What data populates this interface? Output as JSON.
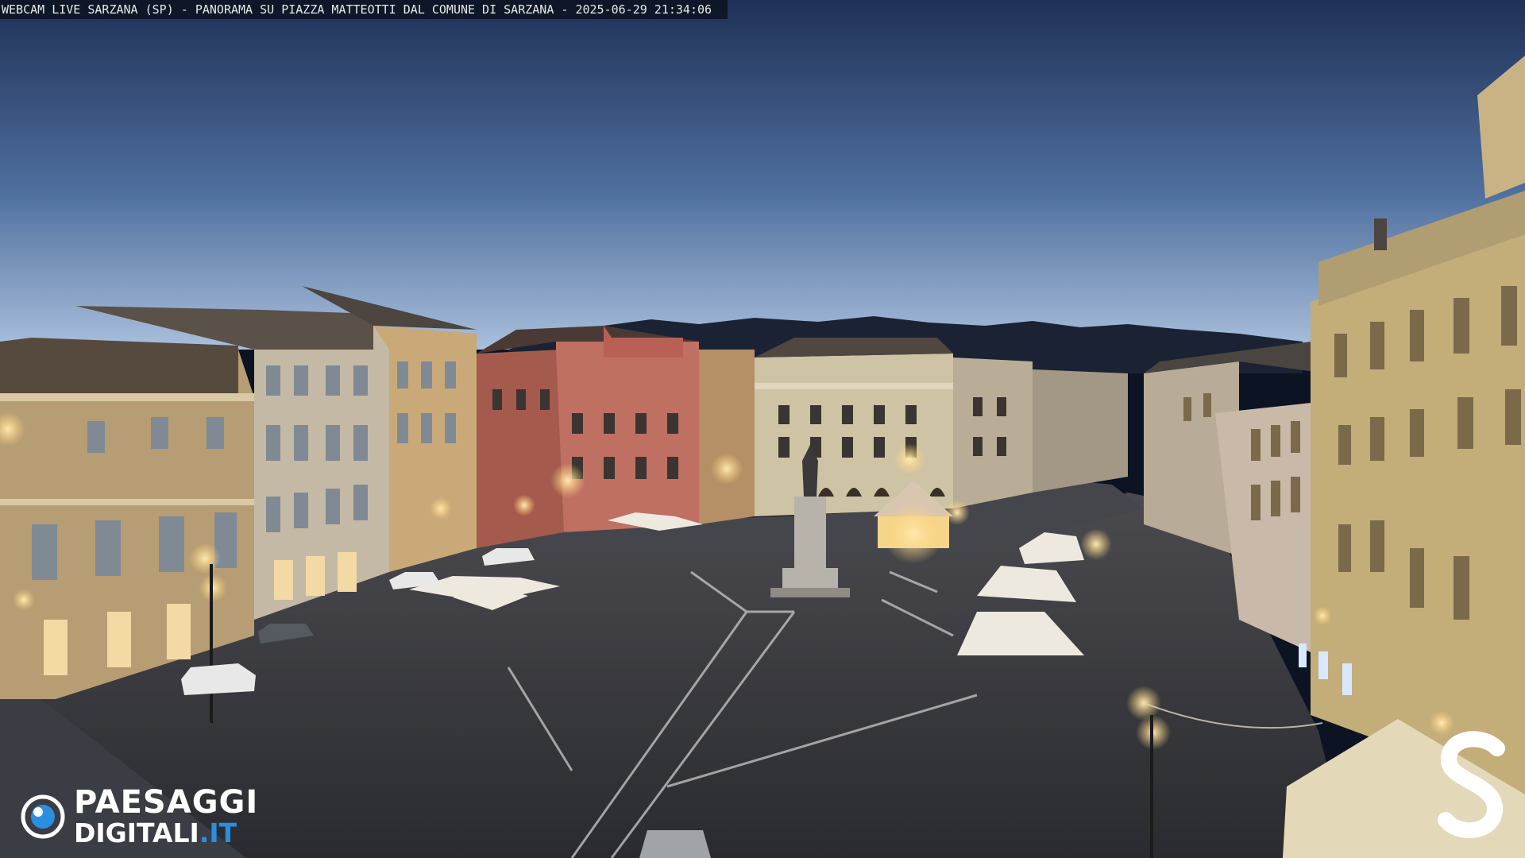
{
  "caption": {
    "text": "WEBCAM LIVE SARZANA (SP) - PANORAMA SU PIAZZA MATTEOTTI DAL COMUNE DI SARZANA - 2025-06-29  21:34:06"
  },
  "logos": {
    "left": {
      "line1": "PAESAGGI",
      "line2_main": "DIGITALI",
      "line2_suffix": ".IT",
      "accent": "#2b8fe0"
    },
    "right": {
      "glyph": "S"
    }
  },
  "colors": {
    "sky_top": "#23375e",
    "sky_bottom": "#9bb5d6",
    "mountains": "#1b2233",
    "piazza": "#3f4046",
    "warm_light": "#ffd98a",
    "building_ochre": "#b9a57c",
    "building_red": "#a45a4d"
  }
}
